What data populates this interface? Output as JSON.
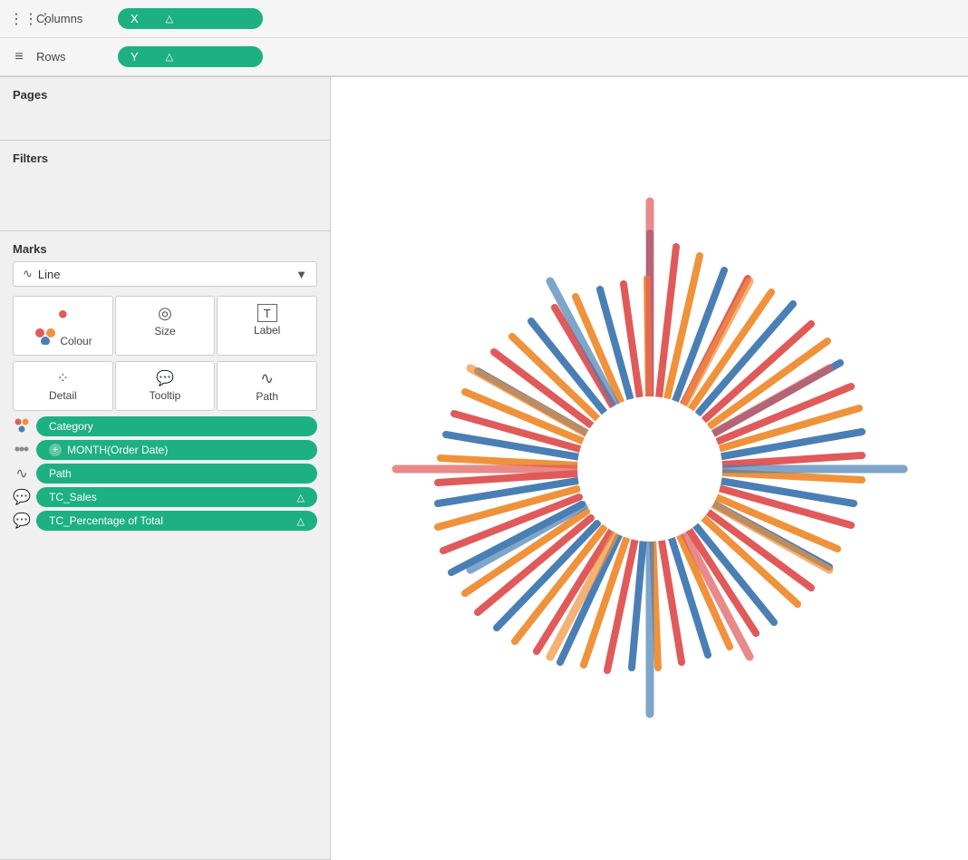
{
  "pages": {
    "label": "Pages"
  },
  "filters": {
    "label": "Filters"
  },
  "marks": {
    "label": "Marks",
    "type": "Line",
    "buttons": [
      {
        "label": "Colour",
        "icon": "⬤"
      },
      {
        "label": "Size",
        "icon": "◎"
      },
      {
        "label": "Label",
        "icon": "T"
      }
    ],
    "buttons2": [
      {
        "label": "Detail",
        "icon": "⁘"
      },
      {
        "label": "Tooltip",
        "icon": "💬"
      },
      {
        "label": "Path",
        "icon": "∿"
      }
    ],
    "fields": [
      {
        "icon": "dots",
        "label": "Category",
        "hasPlus": false,
        "hasDelta": false
      },
      {
        "icon": "dots2",
        "label": "MONTH(Order Date)",
        "hasPlus": true,
        "hasDelta": false
      },
      {
        "icon": "line",
        "label": "Path",
        "hasPlus": false,
        "hasDelta": false
      },
      {
        "icon": "tooltip",
        "label": "TC_Sales",
        "hasPlus": false,
        "hasDelta": true
      },
      {
        "icon": "tooltip",
        "label": "TC_Percentage of Total",
        "hasPlus": false,
        "hasDelta": true
      }
    ]
  },
  "columns": {
    "label": "Columns",
    "pill": "X"
  },
  "rows": {
    "label": "Rows",
    "pill": "Y"
  },
  "colors": {
    "green": "#1db080",
    "red": "#e05a5a",
    "orange": "#f0923b",
    "blue": "#4a7fb5"
  }
}
